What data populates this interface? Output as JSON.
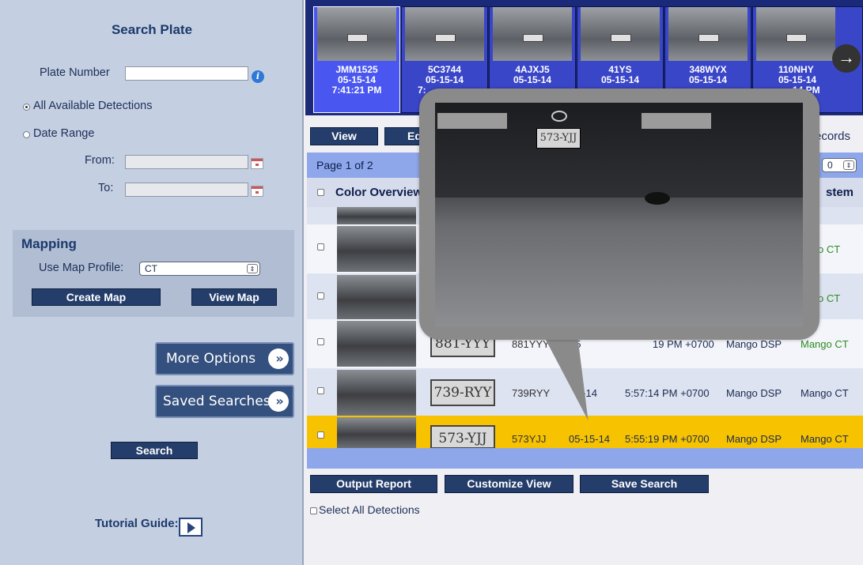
{
  "search_panel": {
    "title": "Search Plate",
    "plate_number_label": "Plate Number",
    "plate_number_value": "",
    "all_detections_label": "All Available Detections",
    "date_range_label": "Date Range",
    "from_label": "From:",
    "to_label": "To:",
    "mapping_title": "Mapping",
    "map_profile_label": "Use Map Profile:",
    "map_profile_value": "CT",
    "create_map": "Create Map",
    "view_map": "View Map",
    "more_options": "More Options",
    "saved_searches": "Saved Searches",
    "search": "Search",
    "tutorial_guide": "Tutorial Guide:"
  },
  "thumbnails": [
    {
      "plate": "JMM1525",
      "date": "05-15-14",
      "time": "7:41:21 PM"
    },
    {
      "plate": "5C3744",
      "date": "05-15-14",
      "time": "7:"
    },
    {
      "plate": "4AJXJ5",
      "date": "05-15-14",
      "time": ""
    },
    {
      "plate": "41YS",
      "date": "05-15-14",
      "time": ""
    },
    {
      "plate": "348WYX",
      "date": "05-15-14",
      "time": ""
    },
    {
      "plate": "110NHY",
      "date": "05-15-14",
      "time": "14 PM"
    }
  ],
  "toolbar": {
    "view": "View",
    "edit": "Ed",
    "records": "ecords"
  },
  "pager": {
    "text": "Page 1 of 2",
    "per_page": "0"
  },
  "table": {
    "headers": {
      "overview": "Color Overview",
      "system": "stem"
    },
    "rows": [
      {
        "plate_img": "",
        "plate": "",
        "date": "",
        "time": "",
        "source": "",
        "system": "o CT"
      },
      {
        "plate_img": "",
        "plate": "",
        "date": "",
        "time": "",
        "source": "",
        "system": "o CT"
      },
      {
        "plate_img": "881-YYY",
        "plate": "881YYY",
        "date": "05",
        "time": "19 PM +0700",
        "source": "Mango DSP",
        "system": "Mango CT"
      },
      {
        "plate_img": "739-RYY",
        "plate": "739RYY",
        "date": "5-14",
        "time": "5:57:14 PM +0700",
        "source": "Mango DSP",
        "system": "Mango CT"
      },
      {
        "plate_img": "573-YJJ",
        "plate": "573YJJ",
        "date": "05-15-14",
        "time": "5:55:19 PM +0700",
        "source": "Mango DSP",
        "system": "Mango CT"
      }
    ]
  },
  "actions": {
    "output_report": "Output Report",
    "customize_view": "Customize View",
    "save_search": "Save Search",
    "select_all": "Select All Detections"
  },
  "popup": {
    "plate_text": "573-YJJ"
  },
  "colors": {
    "selected_row": "#f7c300",
    "row_a": "#dde3f0",
    "row_b": "#f3f5fa",
    "system_green": "#2f8c21"
  }
}
